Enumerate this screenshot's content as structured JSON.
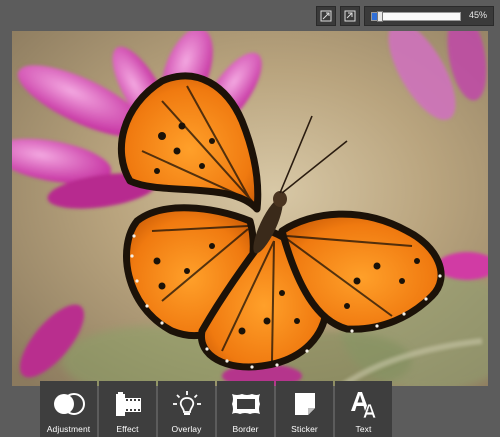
{
  "zoom": {
    "percent_label": "45%",
    "value": 0.45
  },
  "toolbar": {
    "items": [
      {
        "label": "Adjustment",
        "icon": "adjustment-icon"
      },
      {
        "label": "Effect",
        "icon": "effect-film-icon"
      },
      {
        "label": "Overlay",
        "icon": "overlay-bulb-icon"
      },
      {
        "label": "Border",
        "icon": "border-frame-icon"
      },
      {
        "label": "Sticker",
        "icon": "sticker-icon"
      },
      {
        "label": "Text",
        "icon": "text-icon"
      }
    ]
  },
  "canvas": {
    "subject": "orange-butterfly-photo"
  },
  "colors": {
    "background": "#5c5c5c",
    "tool_bg": "#3e3e3e",
    "accent": "#2f6fd8"
  }
}
